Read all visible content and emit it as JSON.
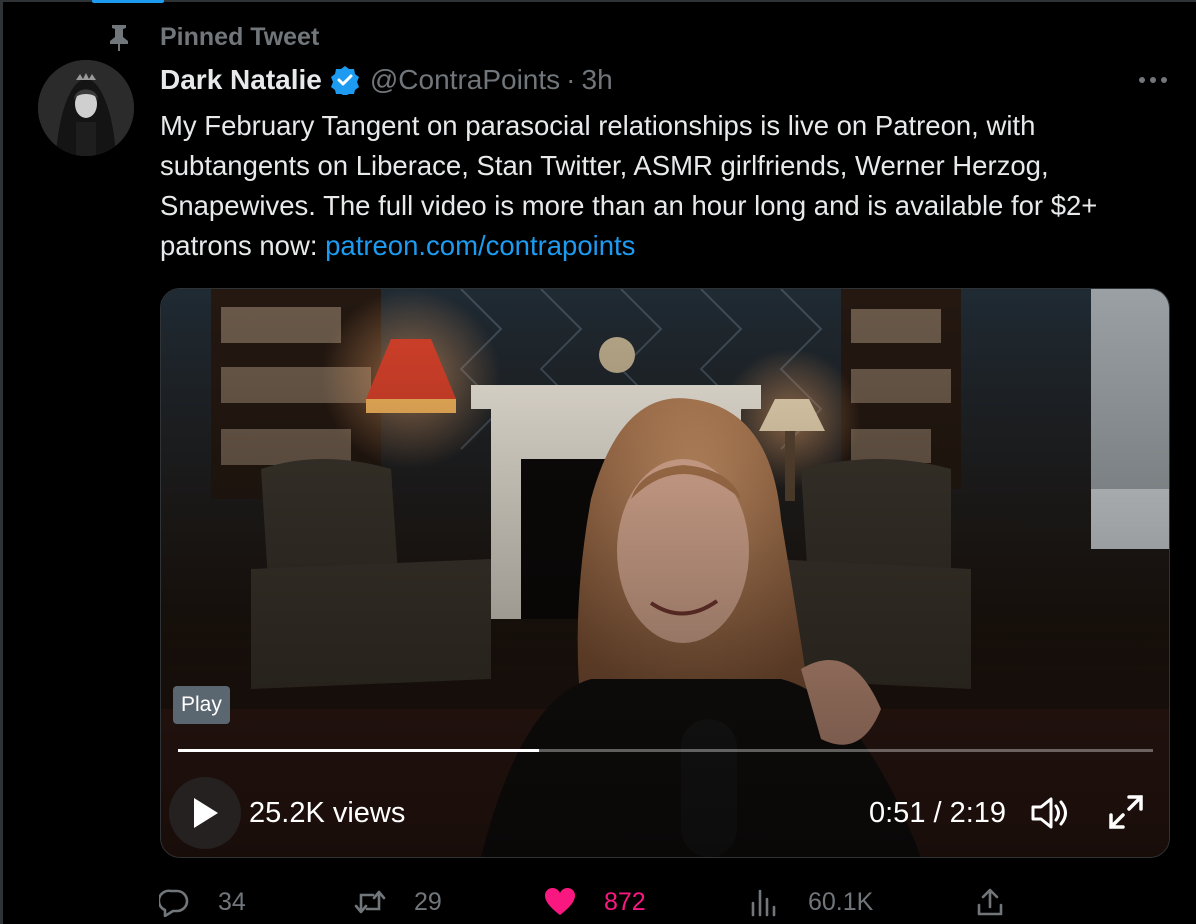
{
  "tweet": {
    "pinned_label": "Pinned Tweet",
    "display_name": "Dark Natalie",
    "handle": "@ContraPoints",
    "separator": "·",
    "time": "3h",
    "text": "My February Tangent on parasocial relationships is live on Patreon, with subtangents on Liberace, Stan Twitter, ASMR girlfriends, Werner Herzog, Snapewives. The full video is more than an hour long and is available for $2+ patrons now: ",
    "link_text": "patreon.com/contrapoints",
    "verified": true
  },
  "video": {
    "play_tooltip": "Play",
    "views": "25.2K views",
    "timecode": "0:51 / 2:19",
    "progress_fraction": 0.37
  },
  "actions": {
    "replies": "34",
    "retweets": "29",
    "likes": "872",
    "liked": true,
    "views": "60.1K"
  },
  "icons": {
    "pin": "pin-icon",
    "verified": "verified-badge-icon",
    "more": "more-icon",
    "play": "play-icon",
    "volume": "volume-icon",
    "fullscreen": "fullscreen-icon",
    "reply": "reply-icon",
    "retweet": "retweet-icon",
    "like": "heart-icon",
    "views": "views-icon",
    "share": "share-icon"
  },
  "colors": {
    "background": "#000000",
    "text": "#e7e9ea",
    "muted": "#71767b",
    "link": "#1d9bf0",
    "like": "#f91880",
    "verified": "#1d9bf0"
  }
}
